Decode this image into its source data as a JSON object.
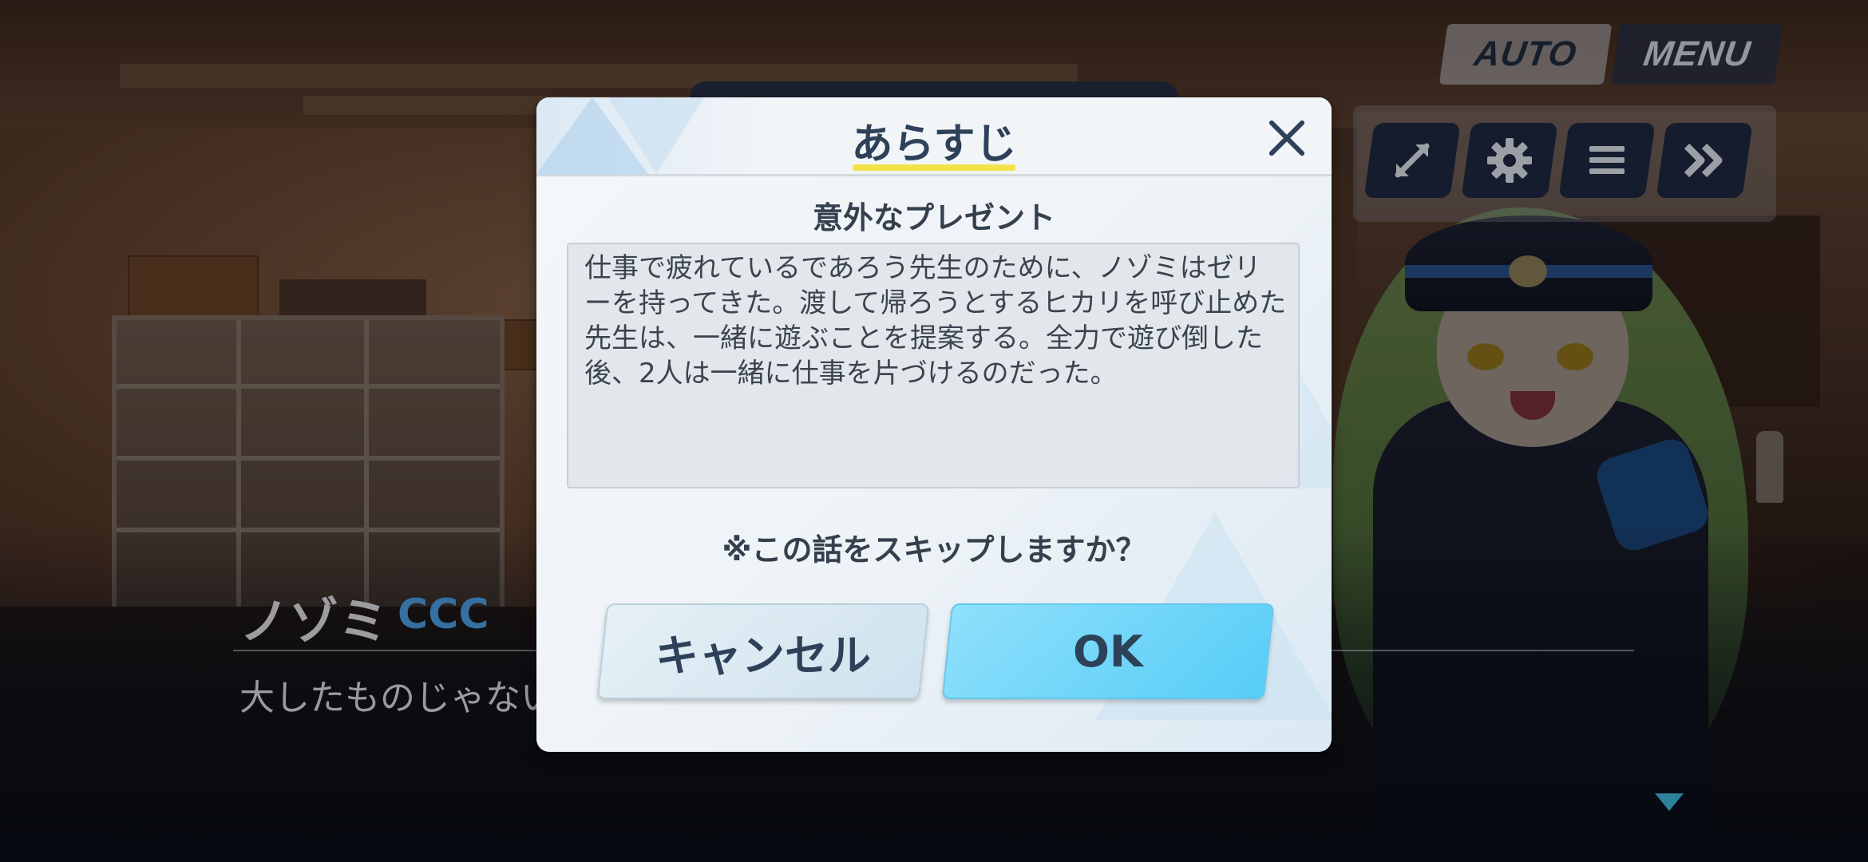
{
  "hud": {
    "auto_label": "AUTO",
    "menu_label": "MENU",
    "icons": [
      "fullscreen-arrows-icon",
      "gear-icon",
      "list-icon",
      "fast-forward-icon"
    ]
  },
  "dialogue": {
    "speaker": "ノゾミ",
    "club": "CCC",
    "text": "大したものじゃない"
  },
  "modal": {
    "title": "あらすじ",
    "episode_title": "意外なプレゼント",
    "summary": "仕事で疲れているであろう先生のために、ノゾミはゼリーを持ってきた。渡して帰ろうとするヒカリを呼び止めた先生は、一緒に遊ぶことを提案する。全力で遊び倒した後、2人は一緒に仕事を片づけるのだった。",
    "question": "※この話をスキップしますか？",
    "cancel_label": "キャンセル",
    "ok_label": "OK"
  },
  "colors": {
    "accent_underline": "#f4e24a",
    "ok_button": "#6fd6f9",
    "text_dark": "#2d4159",
    "club_blue": "#4a9be0"
  }
}
